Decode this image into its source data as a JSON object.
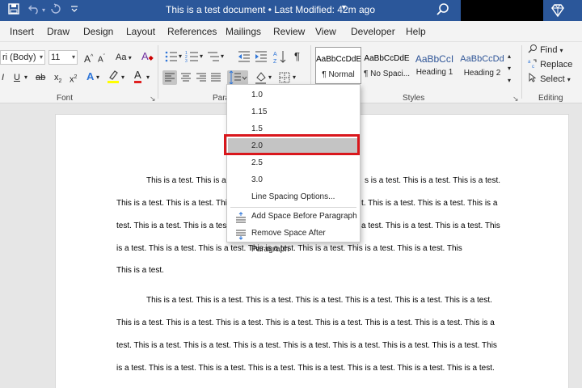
{
  "titlebar": {
    "document_title": "This is a test document • Last Modified: 42m ago",
    "save_icon": "save-icon",
    "undo_icon": "undo-icon",
    "redo_icon": "redo-icon",
    "customize_icon": "customize-qat-icon",
    "search_icon": "search-icon",
    "diamond_icon": "diamond-icon"
  },
  "tabs": [
    "Insert",
    "Draw",
    "Design",
    "Layout",
    "References",
    "Mailings",
    "Review",
    "View",
    "Developer",
    "Help"
  ],
  "font_group": {
    "font_name": "ri (Body)",
    "font_size": "11",
    "grow": "A",
    "shrink": "A",
    "case_label": "Aa",
    "clear_label": "A",
    "italic": "I",
    "underline": "U",
    "strike": "ab",
    "subscript_base": "x",
    "subscript_sub": "2",
    "superscript_base": "x",
    "superscript_sup": "2",
    "effects": "A",
    "font_color": "A",
    "label": "Font",
    "launcher": "↘"
  },
  "paragraph_group": {
    "label": "Para",
    "show_marks": "¶"
  },
  "styles_group": {
    "label": "Styles",
    "launcher": "↘",
    "items": [
      {
        "preview": "AaBbCcDdE",
        "name": "¶ Normal"
      },
      {
        "preview": "AaBbCcDdE",
        "name": "¶ No Spaci..."
      },
      {
        "preview": "AaBbCcI",
        "name": "Heading 1"
      },
      {
        "preview": "AaBbCcDd",
        "name": "Heading 2"
      }
    ]
  },
  "editing_group": {
    "label": "Editing",
    "find": "Find",
    "replace": "Replace",
    "select": "Select"
  },
  "line_spacing_menu": {
    "options": [
      "1.0",
      "1.15",
      "1.5",
      "2.0",
      "2.5",
      "3.0"
    ],
    "selected": "2.0",
    "more_options": "Line Spacing Options...",
    "add_space": "Add Space Before Paragraph",
    "remove_space": "Remove Space After Paragraph",
    "highlight_color": "#d9171c"
  },
  "document": {
    "p1_line1_left": "This is a test. This is a",
    "p1_line1_right": "s is a test. This is a test. This is a test.",
    "p1_line2_left": "This is a test. This is a test. This",
    "p1_line2_right": "t. This is a test. This is a test. This is a",
    "p1_line3_left": "test. This is a test. This is a test.",
    "p1_line3_right": "a test. This is a test. This is a test. This",
    "p1_line4": "is a test. This is a test. This is a test. This is a test. This is a test. This is a test. This is a test. This",
    "p1_line5": "This is a test.",
    "p2_line1": "This is a test. This is a test. This is a test. This is a test. This is a test. This is a test. This is a test.",
    "p2_line2": "This is a test. This is a test. This is a test. This is a test. This is a test. This is a test. This is a test. This is a",
    "p2_line3": "test. This is a test. This is a test. This is a test. This is a test. This is a test. This is a test. This is a test. This",
    "p2_line4": "is a test. This is a test. This is a test. This is a test. This is a test. This is a test. This is a test. This is a test."
  }
}
